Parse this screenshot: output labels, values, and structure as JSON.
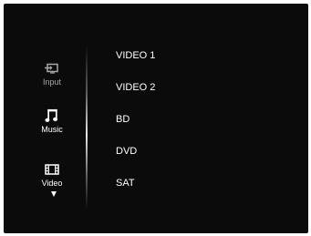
{
  "sidebar": {
    "items": [
      {
        "label": "Input",
        "icon": "input-icon",
        "state": "dim"
      },
      {
        "label": "Music",
        "icon": "music-note-icon",
        "state": "active"
      },
      {
        "label": "Video",
        "icon": "film-icon",
        "state": "active"
      }
    ],
    "more_icon": "triangle-down-icon"
  },
  "sources": {
    "items": [
      "VIDEO 1",
      "VIDEO 2",
      "BD",
      "DVD",
      "SAT"
    ]
  },
  "colors": {
    "background": "#0b0b0b",
    "text": "#ffffff",
    "dim_text": "#a8a8a8"
  }
}
